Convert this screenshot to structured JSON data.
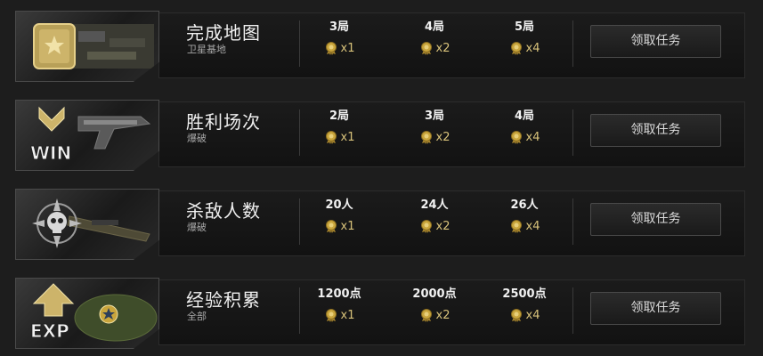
{
  "tasks": [
    {
      "title": "完成地图",
      "subtitle": "卫星基地",
      "icon": "map-medal-icon",
      "tiers": [
        {
          "req": "3局",
          "reward": "x1"
        },
        {
          "req": "4局",
          "reward": "x2"
        },
        {
          "req": "5局",
          "reward": "x4"
        }
      ],
      "button": "领取任务"
    },
    {
      "title": "胜利场次",
      "subtitle": "爆破",
      "icon": "win-chevron-icon",
      "badge_text": "WIN",
      "tiers": [
        {
          "req": "2局",
          "reward": "x1"
        },
        {
          "req": "3局",
          "reward": "x2"
        },
        {
          "req": "4局",
          "reward": "x4"
        }
      ],
      "button": "领取任务"
    },
    {
      "title": "杀敌人数",
      "subtitle": "爆破",
      "icon": "skull-icon",
      "tiers": [
        {
          "req": "20人",
          "reward": "x1"
        },
        {
          "req": "24人",
          "reward": "x2"
        },
        {
          "req": "26人",
          "reward": "x4"
        }
      ],
      "button": "领取任务"
    },
    {
      "title": "经验积累",
      "subtitle": "全部",
      "icon": "exp-arrow-icon",
      "badge_text": "EXP",
      "tiers": [
        {
          "req": "1200点",
          "reward": "x1"
        },
        {
          "req": "2000点",
          "reward": "x2"
        },
        {
          "req": "2500点",
          "reward": "x4"
        }
      ],
      "button": "领取任务"
    }
  ],
  "colors": {
    "reward": "#d8c27a",
    "medal": "#c9a53c"
  }
}
